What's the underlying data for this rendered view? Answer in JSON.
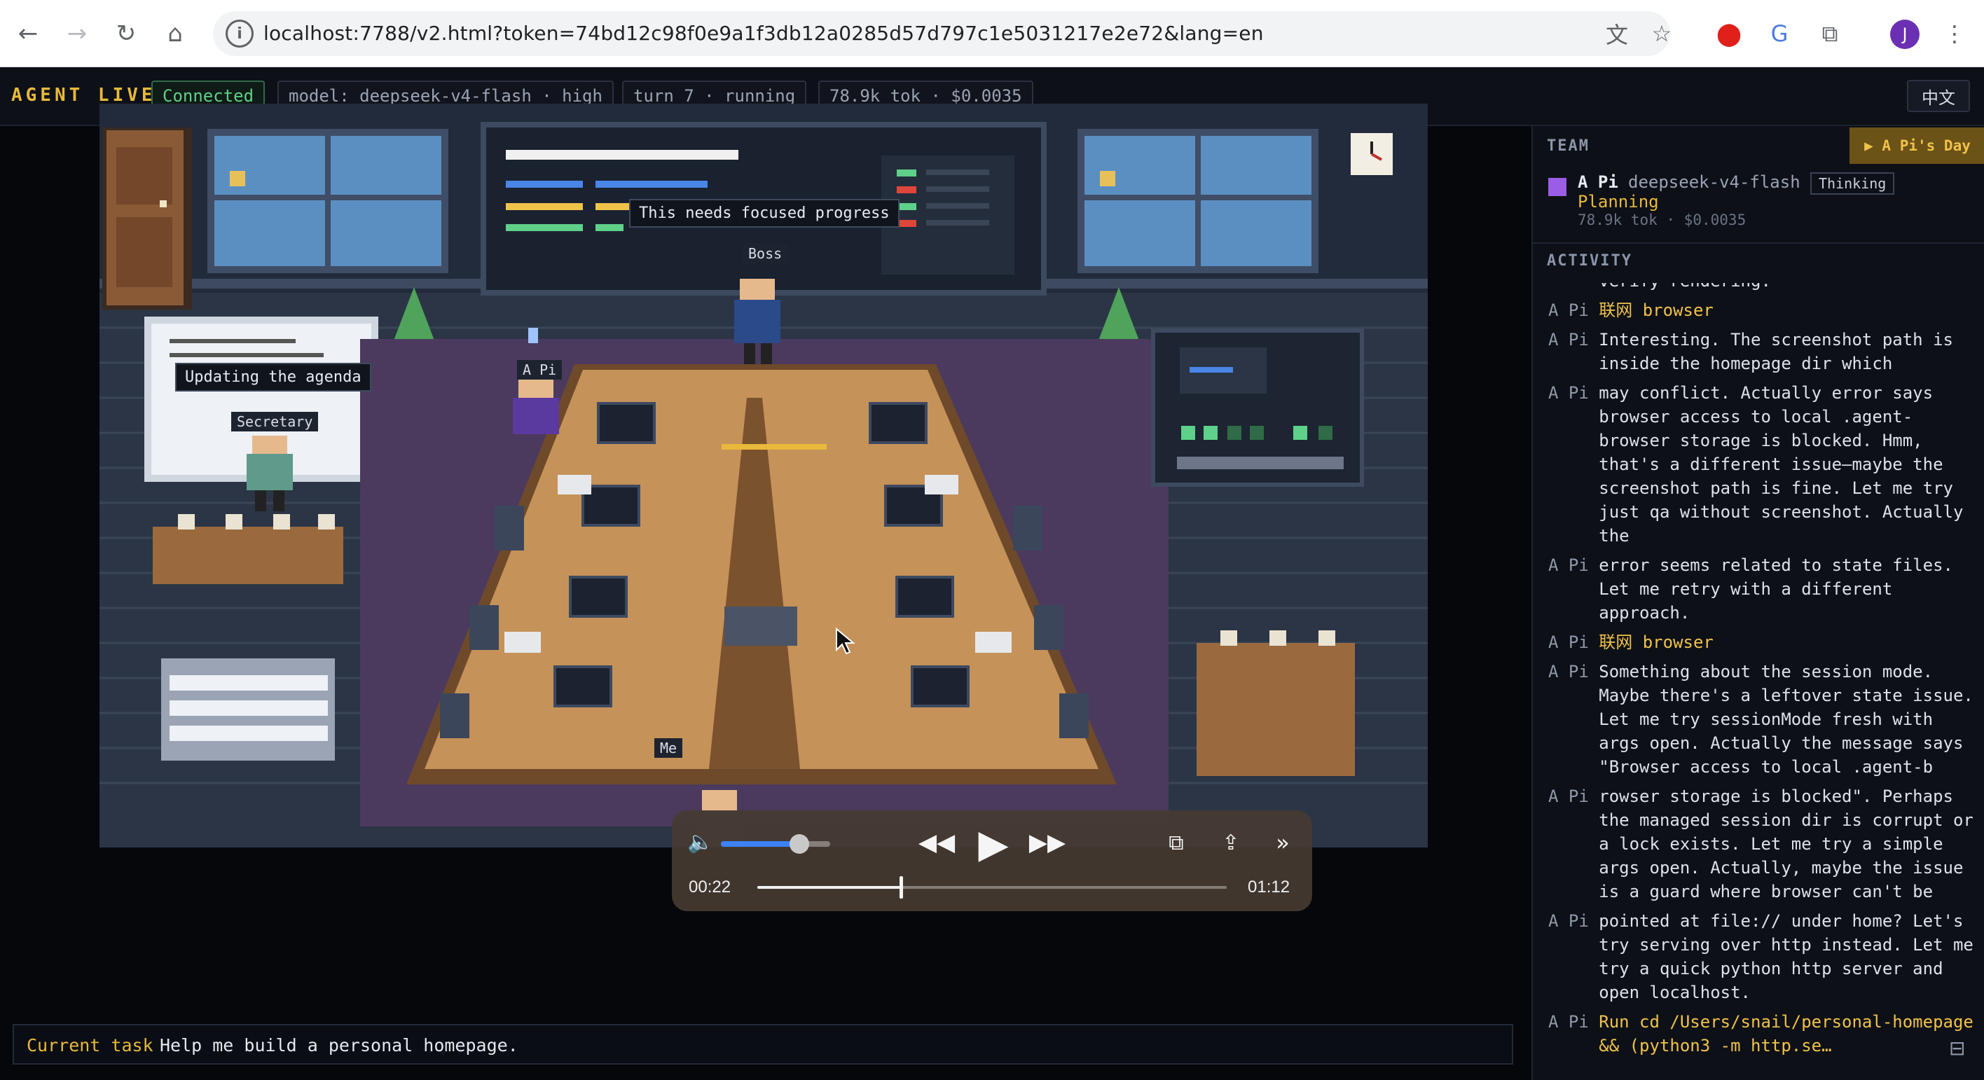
{
  "browser": {
    "url": "localhost:7788/v2.html?token=74bd12c98f0e9a1f3db12a0285d57d797c1e5031217e2e72&lang=en",
    "profile_initial": "J"
  },
  "header": {
    "brand": "AGENT LIVE",
    "status": "Connected",
    "model": "model: deepseek-v4-flash · high",
    "turn": "turn 7 · running",
    "usage": "78.9k tok · $0.0035",
    "lang_button": "中文"
  },
  "scene": {
    "boss_speech": "This needs focused progress",
    "boss_name": "Boss",
    "secretary_speech": "Updating the agenda",
    "secretary_name": "Secretary",
    "agent_name": "A Pi",
    "partial_tag": "Me"
  },
  "video": {
    "current_time": "00:22",
    "duration": "01:12",
    "progress": 0.306,
    "volume": 0.72
  },
  "task": {
    "label": "Current task",
    "text": "Help me build a personal homepage."
  },
  "side": {
    "team_heading": "TEAM",
    "day_button": "▶ A Pi's Day",
    "member": {
      "name": "A Pi",
      "model": "deepseek-v4-flash",
      "badge": "Thinking",
      "status": "Planning",
      "meta": "78.9k tok · $0.0035",
      "color": "#9b5de5"
    },
    "activity_heading": "ACTIVITY",
    "activity": [
      {
        "who": "",
        "lines": [
          "verify rendering."
        ],
        "tool": false
      },
      {
        "who": "A Pi",
        "lines": [
          "联网 browser"
        ],
        "tool": true
      },
      {
        "who": "A Pi",
        "lines": [
          "Interesting. The screenshot path is",
          "inside the homepage dir which"
        ],
        "tool": false
      },
      {
        "who": "A Pi",
        "lines": [
          "may conflict. Actually error says",
          "browser access to local .agent-",
          "browser storage is blocked. Hmm,",
          "that's a different issue—maybe the",
          "screenshot path is fine. Let me try",
          "just qa without screenshot. Actually",
          "the"
        ],
        "tool": false
      },
      {
        "who": "A Pi",
        "lines": [
          "error seems related to state files.",
          "Let me retry with a different",
          "approach."
        ],
        "tool": false
      },
      {
        "who": "A Pi",
        "lines": [
          "联网 browser"
        ],
        "tool": true
      },
      {
        "who": "A Pi",
        "lines": [
          "Something about the session mode.",
          "Maybe there's a leftover state issue.",
          "Let me try sessionMode fresh with",
          "args open. Actually the message says",
          "\"Browser access to local .agent-b"
        ],
        "tool": false
      },
      {
        "who": "A Pi",
        "lines": [
          "rowser storage is blocked\". Perhaps",
          "the managed session dir is corrupt or",
          "a lock exists. Let me try a simple",
          "args open. Actually, maybe the issue",
          "is a guard where browser can't be"
        ],
        "tool": false
      },
      {
        "who": "A Pi",
        "lines": [
          "pointed at file:// under home? Let's",
          "try serving over http instead. Let me",
          "try a quick python http server and",
          "open localhost."
        ],
        "tool": false
      },
      {
        "who": "A Pi",
        "lines": [
          "Run cd /Users/snail/personal-homepage",
          "&& (python3 -m http.se…"
        ],
        "tool": true
      }
    ]
  }
}
